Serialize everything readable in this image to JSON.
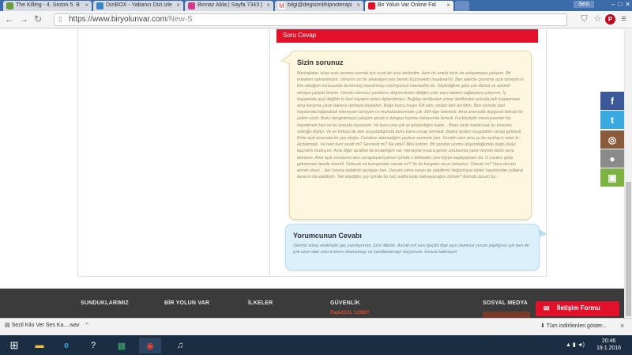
{
  "browser": {
    "tabs": [
      {
        "title": "The Killing - 4. Sezon 5. B",
        "color": "#6a9c3f"
      },
      {
        "title": "DiziBOX - Yabancı Dizi izle",
        "color": "#3c87c5"
      },
      {
        "title": "Binnaz Abla | Sayfa 7343 |",
        "color": "#d23c8a"
      },
      {
        "title": "bilgi@degisimlihipnoterapi",
        "color": "#d93025"
      },
      {
        "title": "Bir Yolun Var Online Fal",
        "color": "#e3102a"
      }
    ],
    "user": "Sezi",
    "url_host": "https://www.biryolunvar.com",
    "url_path": "/New-S"
  },
  "page": {
    "section_header": "Soru Cevap",
    "question_title": "Sizin sorunuz",
    "question_text": "Merhabalar, biraz evet sorumu sormak için ucun bir süre bekledim. Hem bu arada falım da anlayamaya çalıştım. Bir erkekten bahsetmişim. Umarım siz bir arkadaşım olur benim Eşcinseliim maalesef ki. Ben ailemle çevreme açık birisiyim ki kim olduğum konusunda da kimseyi kandırmayı istemiyorum istemedim de. Söylediğime göre çok dürüst ve adaletli olmaya çalışan biriyim. Olumlu olumsuz yanlarımı düşünmeden bildiğim yolu veya adaleti sağlamaya çalışırım. İş hayatımda açık değilim ki özel hayatım onları ilgilendirmez. Buğday tenlilerden ermer tenlilerden aslında pek hoşlanmam ama karşıma çıkan bakarız demeye başladım. Boğa burcu insanı Elif yani, ondan ben ayrıldım. Ben aslında özel hayatımda kalpbokluk istemeyen birisiyim ve muhafazakarımdır çok. Elif olgu istemedi. Ama aramızda duygusal fiziksel bir çekim vardı. Bunu dengelemeye çalıştım ancak o dengeyi bozma noktasında ilerledi. Fuckbodylik mevzusundan hiç hazettmem ben ve bu konuda hassasım. Ve bunu ona çok iyi gösterdiğim halde... Biraz saskı kandırıcak bu konuma soktuğu ilişkiyi. Ve en kötüsü de ben sorguladığımda bunu bana cevap vermedi. Başka şeyleri sorguladım cevap gelmedi. Kinle açık arasında bir şey oluştu. Cevabını alamadığım şeylere sevmem ben. Sevdim seni ama şu bu açıklayın veter ki... Açıklamadı. Ve hani beni sevdi mi? Sevmedi mi? Ne oldu? Bilsi koldım. Bir yandan uyumu düşündüğümde doğru kişiyi kaçırdım muduyım. Ama diğer taraftan da kırdarlığım var. Herneyse kısaca gelsin sorularıma yanıt verirsin bitsin veya bitmesin. Ama açık sorularımı ben cevaplayamıyorum içimde o bitmeden yeni kişiye başlayamam da. O yüzden gelip gelmemesi bende önemli. Gelecek mi konuşmalar olacak mı? Ya da kavgalar olsun farketmz. Olacak mı? Veya devam etmek olsun... Her karara alabilirim açıkgası ben. Devamı etme kararı da alabilirim/ değişmişse tabiki/ hayatımdan yollama kararını da alabilirim. Tek istediğim şey içimde bu tarz arafta kalıp kalmayacağını bilmek? Aslında durum bu...",
    "answer_title": "Yorumcunun Cevabı",
    "answer_text": "Sıkıntılı süreç nedeniyle geç yanıtlıyorum, özür dilerim. Ancak sırf soru geçikti diye aşırı olumsuz yorum yaptığınız için ben de çok uzun olan soru kısmını okumamayı ve yanıtlamamayı seçiyorum. kusura bakmayın"
  },
  "social": [
    {
      "icon": "f",
      "name": "facebook",
      "color": "#3b5998"
    },
    {
      "icon": "t",
      "name": "twitter",
      "color": "#39a9e0"
    },
    {
      "icon": "◎",
      "name": "instagram",
      "color": "#8a5a3c"
    },
    {
      "icon": "",
      "name": "apple",
      "color": "#8a8a8a"
    },
    {
      "icon": "▣",
      "name": "android",
      "color": "#7cb342"
    }
  ],
  "footer": {
    "col1": "SUNDUKLARIMIZ",
    "col2": "BİR YOLUN VAR",
    "col3": "İLKELER",
    "col4": "GÜVENLİK",
    "col5": "SOSYAL MEDYA",
    "contact": "İletişim Formu"
  },
  "downloads": {
    "item": "Sezil Kilo Ver Ses Ka....wav",
    "show_all": "Tüm indirilenleri göster..."
  },
  "taskbar": {
    "time": "20:46",
    "date": "19.1.2016"
  }
}
